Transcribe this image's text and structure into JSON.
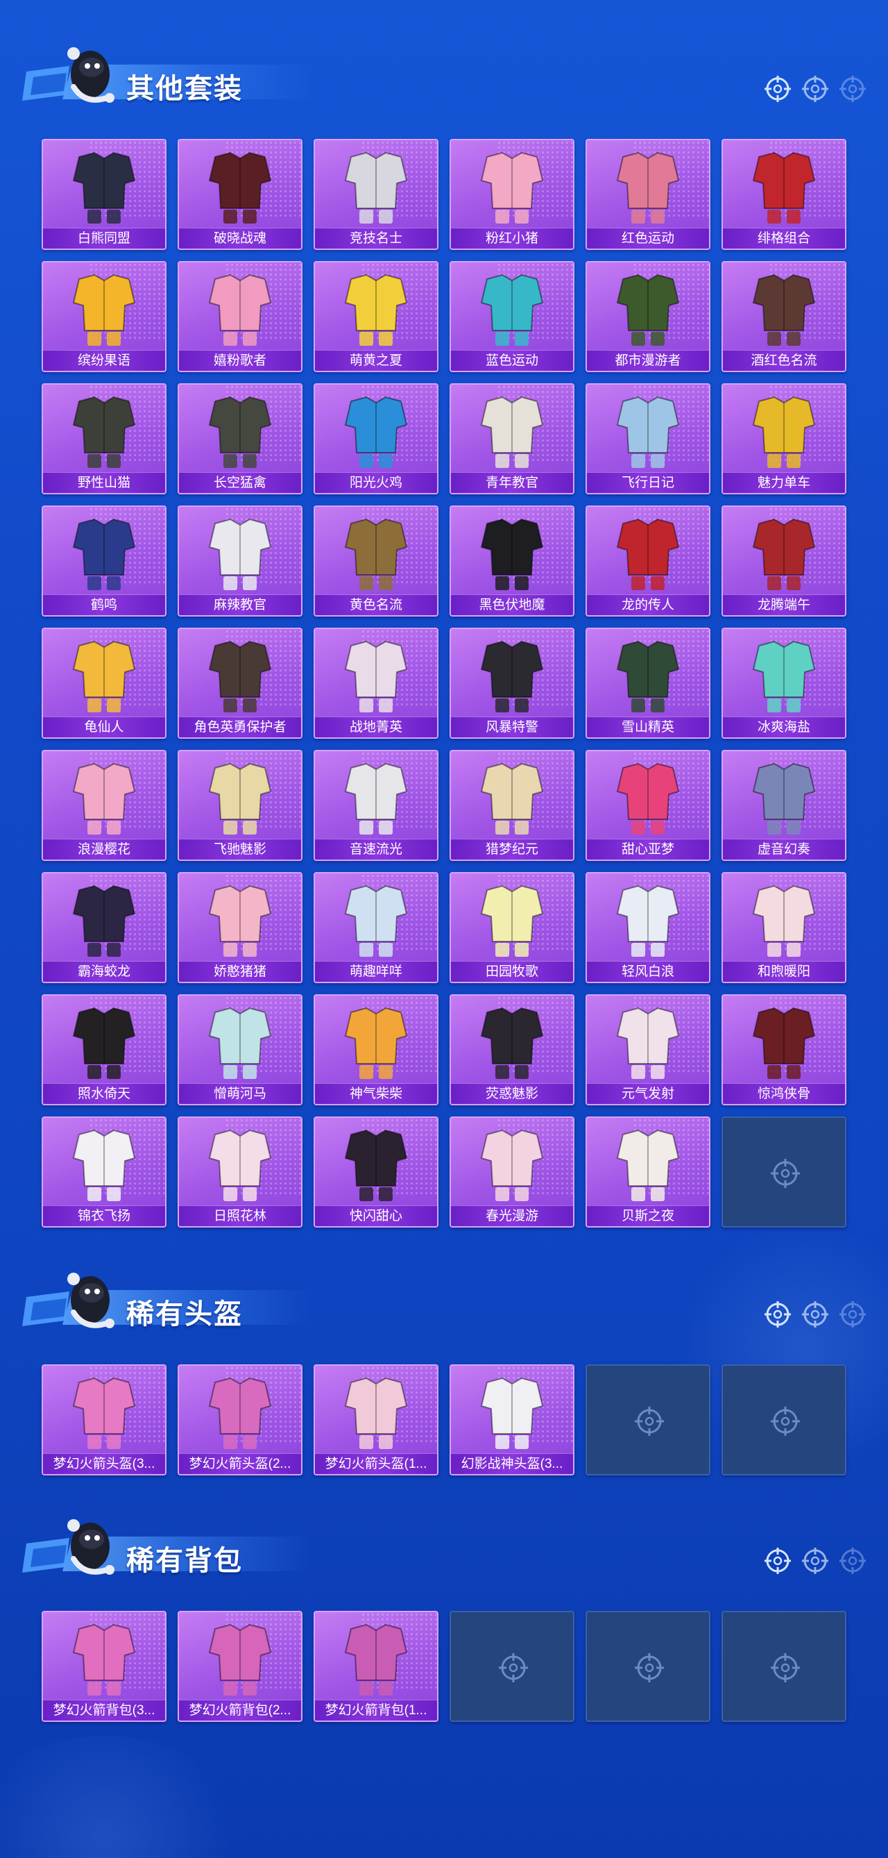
{
  "sections": [
    {
      "title": "其他套装",
      "icon": "mascot-character-icon",
      "items": [
        {
          "label": "白熊同盟",
          "accent": "#2a2e45",
          "empty": false
        },
        {
          "label": "破晓战魂",
          "accent": "#5a1f24",
          "empty": false
        },
        {
          "label": "竞技名士",
          "accent": "#d8d6df",
          "empty": false
        },
        {
          "label": "粉红小猪",
          "accent": "#f3a8c6",
          "empty": false
        },
        {
          "label": "红色运动",
          "accent": "#e07a97",
          "empty": false
        },
        {
          "label": "绯格组合",
          "accent": "#c0262c",
          "empty": false
        },
        {
          "label": "缤纷果语",
          "accent": "#f4b52a",
          "empty": false
        },
        {
          "label": "嬉粉歌者",
          "accent": "#f19bc1",
          "empty": false
        },
        {
          "label": "萌黄之夏",
          "accent": "#f2cf3a",
          "empty": false
        },
        {
          "label": "蓝色运动",
          "accent": "#37b8c9",
          "empty": false
        },
        {
          "label": "都市漫游者",
          "accent": "#3d5a2c",
          "empty": false
        },
        {
          "label": "酒红色名流",
          "accent": "#5c3a33",
          "empty": false
        },
        {
          "label": "野性山猫",
          "accent": "#3d3f39",
          "empty": false
        },
        {
          "label": "长空猛禽",
          "accent": "#45483f",
          "empty": false
        },
        {
          "label": "阳光火鸡",
          "accent": "#2a8fd8",
          "empty": false
        },
        {
          "label": "青年教官",
          "accent": "#e5e0d8",
          "empty": false
        },
        {
          "label": "飞行日记",
          "accent": "#9ec5e6",
          "empty": false
        },
        {
          "label": "魅力单车",
          "accent": "#e6b928",
          "empty": false
        },
        {
          "label": "鹤鸣",
          "accent": "#2b3b8c",
          "empty": false
        },
        {
          "label": "麻辣教官",
          "accent": "#e8e8ee",
          "empty": false
        },
        {
          "label": "黄色名流",
          "accent": "#8d6e3a",
          "empty": false
        },
        {
          "label": "黑色伏地魔",
          "accent": "#1e1e22",
          "empty": false
        },
        {
          "label": "龙的传人",
          "accent": "#c0252e",
          "empty": false
        },
        {
          "label": "龙腾端午",
          "accent": "#a8272b",
          "empty": false
        },
        {
          "label": "龟仙人",
          "accent": "#f3b93a",
          "empty": false
        },
        {
          "label": "角色英勇保护者",
          "accent": "#4a3a36",
          "empty": false
        },
        {
          "label": "战地菁英",
          "accent": "#e9dce8",
          "empty": false
        },
        {
          "label": "风暴特警",
          "accent": "#2a2a30",
          "empty": false
        },
        {
          "label": "雪山精英",
          "accent": "#2f4a36",
          "empty": false
        },
        {
          "label": "冰爽海盐",
          "accent": "#5fd1c4",
          "empty": false
        },
        {
          "label": "浪漫樱花",
          "accent": "#f4a8c8",
          "empty": false
        },
        {
          "label": "飞驰魅影",
          "accent": "#e7d8a6",
          "empty": false
        },
        {
          "label": "音速流光",
          "accent": "#e6e6ea",
          "empty": false
        },
        {
          "label": "猎梦纪元",
          "accent": "#e9d7b0",
          "empty": false
        },
        {
          "label": "甜心亚梦",
          "accent": "#e7437a",
          "empty": false
        },
        {
          "label": "虚音幻奏",
          "accent": "#7b86b8",
          "empty": false
        },
        {
          "label": "霸海蛟龙",
          "accent": "#2b2644",
          "empty": false
        },
        {
          "label": "娇憨猪猪",
          "accent": "#f5b5c8",
          "empty": false
        },
        {
          "label": "萌趣咩咩",
          "accent": "#cfe0f2",
          "empty": false
        },
        {
          "label": "田园牧歌",
          "accent": "#f1eeb0",
          "empty": false
        },
        {
          "label": "轻风白浪",
          "accent": "#e8ecf4",
          "empty": false
        },
        {
          "label": "和煦暖阳",
          "accent": "#f4dbe0",
          "empty": false
        },
        {
          "label": "照水倚天",
          "accent": "#242124",
          "empty": false
        },
        {
          "label": "憎萌河马",
          "accent": "#bfe3e6",
          "empty": false
        },
        {
          "label": "神气柴柴",
          "accent": "#f2a63a",
          "empty": false
        },
        {
          "label": "荧惑魅影",
          "accent": "#2a2730",
          "empty": false
        },
        {
          "label": "元气发射",
          "accent": "#f1e1ea",
          "empty": false
        },
        {
          "label": "惊鸿侠骨",
          "accent": "#6b1e24",
          "empty": false
        },
        {
          "label": "锦衣飞扬",
          "accent": "#f2f0f4",
          "empty": false
        },
        {
          "label": "日照花林",
          "accent": "#f4dde8",
          "empty": false
        },
        {
          "label": "快闪甜心",
          "accent": "#2b2230",
          "empty": false
        },
        {
          "label": "春光漫游",
          "accent": "#f3d3e2",
          "empty": false
        },
        {
          "label": "贝斯之夜",
          "accent": "#f1ece8",
          "empty": false
        },
        {
          "label": "",
          "accent": "",
          "empty": true
        }
      ]
    },
    {
      "title": "稀有头盔",
      "icon": "mascot-character-icon",
      "items": [
        {
          "label": "梦幻火箭头盔(3...",
          "accent": "#e77ac4",
          "empty": false
        },
        {
          "label": "梦幻火箭头盔(2...",
          "accent": "#d86bc0",
          "empty": false
        },
        {
          "label": "梦幻火箭头盔(1...",
          "accent": "#f2c9d9",
          "empty": false
        },
        {
          "label": "幻影战神头盔(3...",
          "accent": "#f0f0f4",
          "empty": false
        },
        {
          "label": "",
          "accent": "",
          "empty": true
        },
        {
          "label": "",
          "accent": "",
          "empty": true
        }
      ]
    },
    {
      "title": "稀有背包",
      "icon": "mascot-character-icon",
      "items": [
        {
          "label": "梦幻火箭背包(3...",
          "accent": "#e26ec0",
          "empty": false
        },
        {
          "label": "梦幻火箭背包(2...",
          "accent": "#d665bb",
          "empty": false
        },
        {
          "label": "梦幻火箭背包(1...",
          "accent": "#c95cb5",
          "empty": false
        },
        {
          "label": "",
          "accent": "",
          "empty": true
        },
        {
          "label": "",
          "accent": "",
          "empty": true
        },
        {
          "label": "",
          "accent": "",
          "empty": true
        }
      ]
    }
  ]
}
